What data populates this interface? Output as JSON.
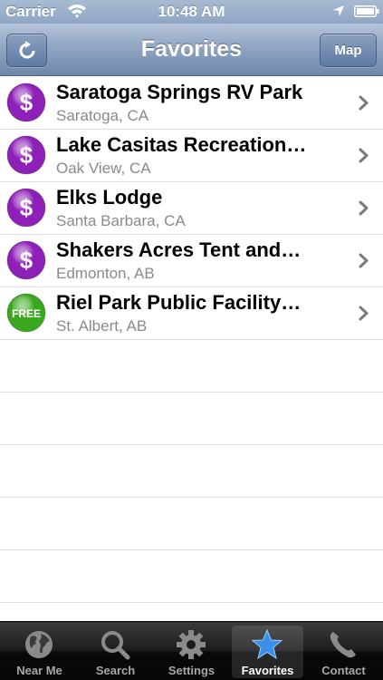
{
  "status_bar": {
    "carrier": "Carrier",
    "time": "10:48 AM"
  },
  "nav": {
    "title": "Favorites",
    "map_label": "Map"
  },
  "favorites": [
    {
      "title": "Saratoga Springs RV Park",
      "subtitle": "Saratoga, CA",
      "badge": "$",
      "badge_type": "paid"
    },
    {
      "title": "Lake Casitas Recreation…",
      "subtitle": "Oak View, CA",
      "badge": "$",
      "badge_type": "paid"
    },
    {
      "title": "Elks Lodge",
      "subtitle": "Santa Barbara, CA",
      "badge": "$",
      "badge_type": "paid"
    },
    {
      "title": "Shakers Acres Tent and…",
      "subtitle": "Edmonton, AB",
      "badge": "$",
      "badge_type": "paid"
    },
    {
      "title": "Riel Park Public Facility…",
      "subtitle": "St. Albert, AB",
      "badge": "FREE",
      "badge_type": "free"
    }
  ],
  "tabs": [
    {
      "label": "Near Me",
      "icon": "globe-icon"
    },
    {
      "label": "Search",
      "icon": "magnifier-icon"
    },
    {
      "label": "Settings",
      "icon": "gear-icon"
    },
    {
      "label": "Favorites",
      "icon": "star-icon",
      "active": true
    },
    {
      "label": "Contact",
      "icon": "phone-icon"
    }
  ],
  "colors": {
    "paid_badge": "#8e1fb8",
    "free_badge": "#3aa81e",
    "active_star": "#3b8fe8"
  }
}
